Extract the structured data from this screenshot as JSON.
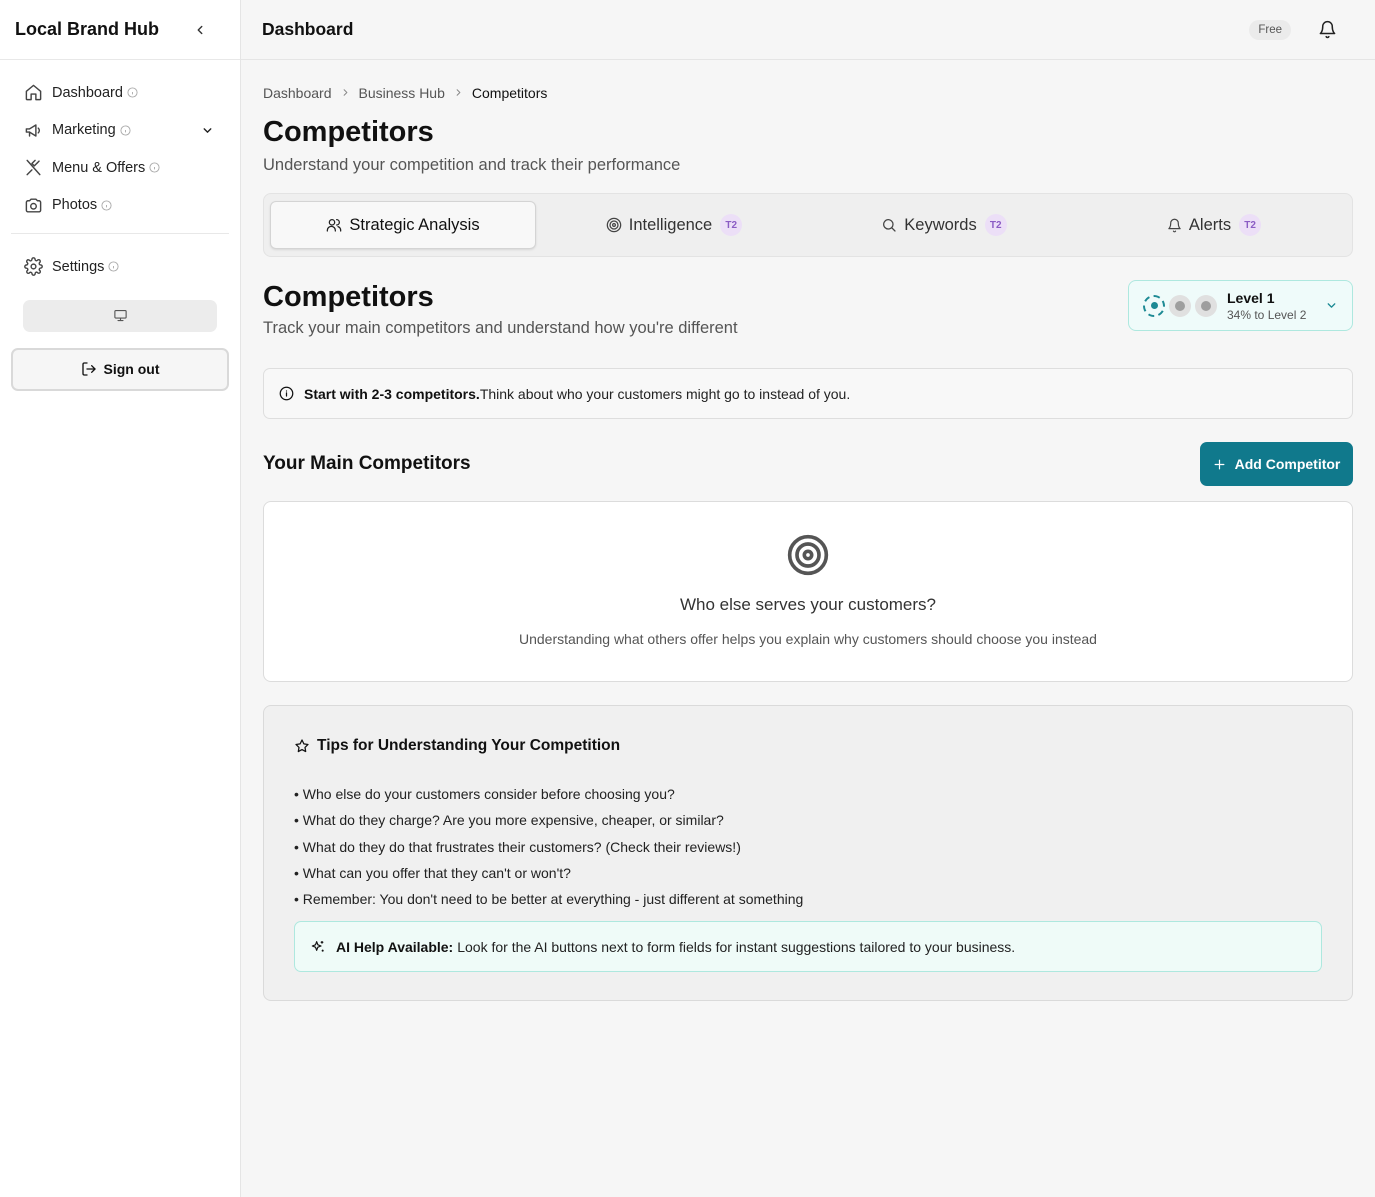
{
  "sidebar": {
    "brand": "Local Brand Hub",
    "items": [
      {
        "label": "Dashboard",
        "icon": "home-icon"
      },
      {
        "label": "Marketing",
        "icon": "megaphone-icon"
      },
      {
        "label": "Menu & Offers",
        "icon": "utensils-icon"
      },
      {
        "label": "Photos",
        "icon": "camera-icon"
      }
    ],
    "settings": {
      "label": "Settings",
      "icon": "gear-icon"
    },
    "signout_label": "Sign out"
  },
  "topbar": {
    "title": "Dashboard",
    "plan": "Free"
  },
  "breadcrumb": [
    "Dashboard",
    "Business Hub",
    "Competitors"
  ],
  "page": {
    "title": "Competitors",
    "subtitle": "Understand your competition and track their performance"
  },
  "tabs": [
    {
      "label": "Strategic Analysis",
      "icon": "users-icon",
      "tier": ""
    },
    {
      "label": "Intelligence",
      "icon": "target-icon",
      "tier": "T2"
    },
    {
      "label": "Keywords",
      "icon": "search-icon",
      "tier": "T2"
    },
    {
      "label": "Alerts",
      "icon": "bell-icon",
      "tier": "T2"
    }
  ],
  "section": {
    "title": "Competitors",
    "subtitle": "Track your main competitors and understand how you're different"
  },
  "level": {
    "name": "Level 1",
    "progress": "34% to Level 2"
  },
  "info": {
    "bold": "Start with 2-3 competitors.",
    "text": "Think about who your customers might go to instead of you."
  },
  "competitors": {
    "title": "Your Main Competitors",
    "add_label": "Add Competitor",
    "empty_title": "Who else serves your customers?",
    "empty_sub": "Understanding what others offer helps you explain why customers should choose you instead"
  },
  "tips": {
    "title": "Tips for Understanding Your Competition",
    "items": [
      "• Who else do your customers consider before choosing you?",
      "• What do they charge? Are you more expensive, cheaper, or similar?",
      "• What do they do that frustrates their customers? (Check their reviews!)",
      "• What can you offer that they can't or won't?",
      "• Remember: You don't need to be better at everything - just different at something"
    ],
    "ai_bold": "AI Help Available:",
    "ai_text": "Look for the AI buttons next to form fields for instant suggestions tailored to your business."
  },
  "colors": {
    "accent": "#10798c",
    "tier_badge": "#8b5cc4",
    "level_border": "#aee8df"
  }
}
